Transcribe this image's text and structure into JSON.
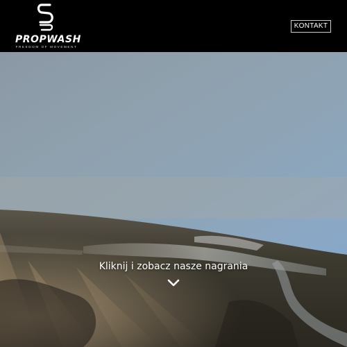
{
  "header": {
    "logo": {
      "wordmark": "PROPWASH",
      "tagline": "FREEDOM OF MOVEMENT"
    },
    "contact_label": "KONTAKT"
  },
  "hero": {
    "cta_text": "Kliknij i zobacz nasze nagrania",
    "scroll_icon": "chevron-down-icon"
  },
  "colors": {
    "header_bg": "#000000",
    "text": "#ffffff"
  }
}
